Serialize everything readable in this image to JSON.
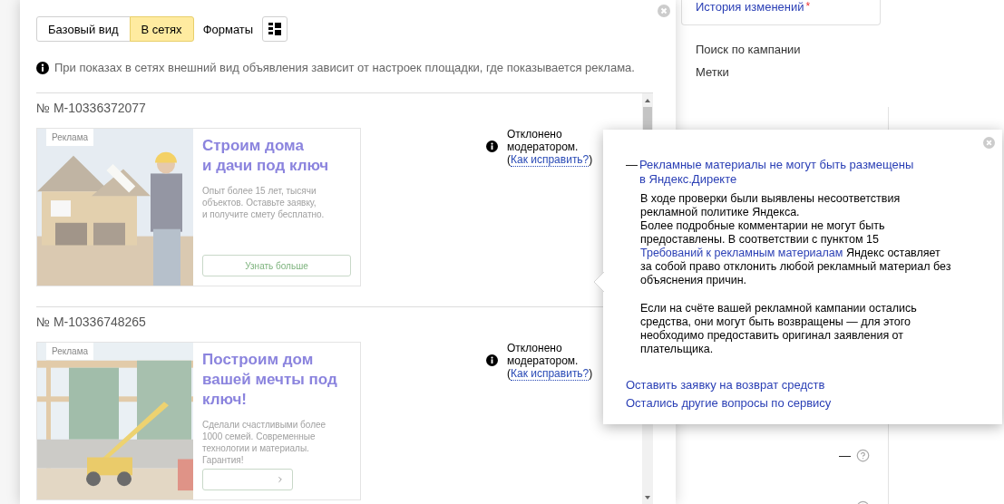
{
  "view_tabs": [
    {
      "label": "Базовый вид",
      "selected": false
    },
    {
      "label": "В сетях",
      "selected": true
    }
  ],
  "formats_label": "Форматы",
  "info_note": "При показах в сетях внешний вид объявления зависит от настроек площадки, где показывается реклама.",
  "ads": [
    {
      "number": "№ M-10336372077",
      "badge": "Реклама",
      "title": "Строим дома\nи дачи под ключ",
      "body": "Опыт более 15 лет, тысячи\nобъектов. Оставьте заявку,\nи получите смету бесплатно.",
      "cta": {
        "kind": "text",
        "label": "Узнать больше"
      },
      "status": {
        "text": "Отклонено модератором.",
        "fix_open": "(",
        "fix_link": "Как исправить?",
        "fix_close": ")"
      }
    },
    {
      "number": "№ M-10336748265",
      "badge": "Реклама",
      "title": "Построим дом\nвашей мечты под\nключ!",
      "body": "Сделали счастливыми более\n1000 семей. Современные\nтехнологии и материалы.\nГарантия!",
      "cta": {
        "kind": "arrow"
      },
      "status": {
        "text": "Отклонено модератором.",
        "fix_open": "(",
        "fix_link": "Как исправить?",
        "fix_close": ")"
      }
    }
  ],
  "side_panel": {
    "history_link": "История изменений",
    "history_marker": "*",
    "links": [
      "Поиск по кампании",
      "Метки"
    ],
    "metric_value": "—"
  },
  "popover": {
    "dash": "—",
    "title": "Рекламные материалы не могут быть размещены в Яндекс.Директе",
    "paragraph_groups": [
      [
        {
          "text": "В ходе проверки были выявлены несоответствия рекламной политике Яндекса."
        },
        {
          "text": "Более подробные комментарии не могут быть предоставлены. В соответствии с пунктом 15",
          "link": "Требований к рекламным материалам",
          "after": "Яндекс оставляет за собой право отклонить любой рекламный материал без объяснения причин."
        }
      ],
      [
        {
          "text": "Если на счёте вашей рекламной кампании остались средства, они могут быть возвращены — для этого необходимо предоставить оригинал заявления от плательщика."
        }
      ]
    ],
    "links": [
      "Оставить заявку на возврат средств",
      "Остались другие вопросы по сервису"
    ]
  }
}
